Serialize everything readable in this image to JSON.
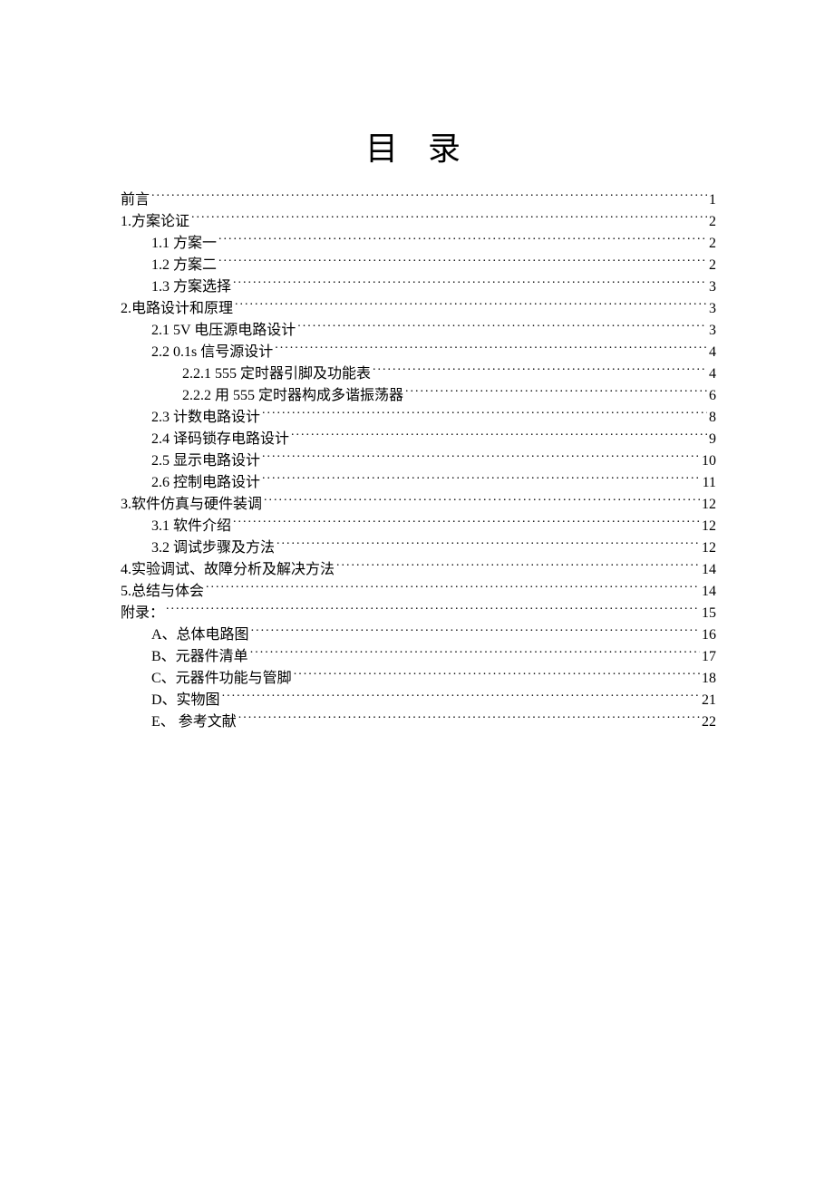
{
  "title": "目 录",
  "entries": [
    {
      "indent": 0,
      "label": "前言",
      "page": "1"
    },
    {
      "indent": 0,
      "label": "1.方案论证",
      "page": "2"
    },
    {
      "indent": 1,
      "label": "1.1 方案一",
      "page": "2"
    },
    {
      "indent": 1,
      "label": "1.2  方案二",
      "page": "2"
    },
    {
      "indent": 1,
      "label": "1.3  方案选择",
      "page": "3"
    },
    {
      "indent": 0,
      "label": "2.电路设计和原理",
      "page": "3"
    },
    {
      "indent": 1,
      "label": "2.1 5V 电压源电路设计",
      "page": "3"
    },
    {
      "indent": 1,
      "label": "2.2 0.1s 信号源设计 ",
      "page": "4"
    },
    {
      "indent": 2,
      "label": "2.2.1 555 定时器引脚及功能表",
      "page": "4"
    },
    {
      "indent": 2,
      "label": "2.2.2  用 555 定时器构成多谐振荡器",
      "page": "6"
    },
    {
      "indent": 1,
      "label": "2.3  计数电路设计",
      "page": "8"
    },
    {
      "indent": 1,
      "label": "2.4 译码锁存电路设计",
      "page": "9"
    },
    {
      "indent": 1,
      "label": "2.5 显示电路设计",
      "page": "10"
    },
    {
      "indent": 1,
      "label": "2.6 控制电路设计",
      "page": "11"
    },
    {
      "indent": 0,
      "label": "3.软件仿真与硬件装调",
      "page": "12"
    },
    {
      "indent": 1,
      "label": "3.1  软件介绍",
      "page": "12"
    },
    {
      "indent": 1,
      "label": "3.2  调试步骤及方法",
      "page": "12"
    },
    {
      "indent": 0,
      "label": "4.实验调试、故障分析及解决方法",
      "page": "14"
    },
    {
      "indent": 0,
      "label": "5.总结与体会",
      "page": "14"
    },
    {
      "indent": 0,
      "label": "附录：",
      "page": "15"
    },
    {
      "indent": 1,
      "label": "A、总体电路图",
      "page": "16"
    },
    {
      "indent": 1,
      "label": "B、元器件清单 ",
      "page": "17"
    },
    {
      "indent": 1,
      "label": "C、元器件功能与管脚 ",
      "page": "18"
    },
    {
      "indent": 1,
      "label": "D、实物图",
      "page": "21"
    },
    {
      "indent": 1,
      "label": "E、 参考文献 ",
      "page": "22"
    }
  ]
}
